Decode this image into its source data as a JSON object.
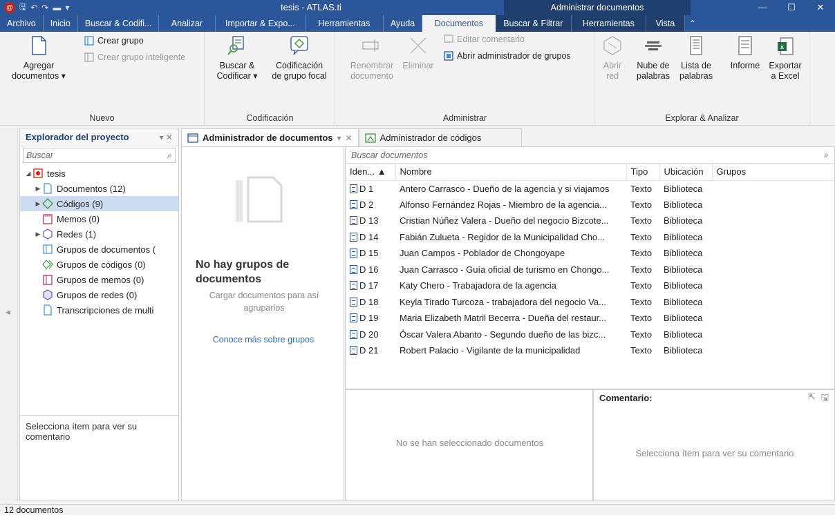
{
  "window": {
    "title": "tesis - ATLAS.ti",
    "context_title": "Administrar documentos",
    "minimize": "—",
    "maximize": "☐",
    "close": "✕"
  },
  "ribbon_tabs": [
    {
      "label": "Archivo"
    },
    {
      "label": "Inicio"
    },
    {
      "label": "Buscar & Codifi..."
    },
    {
      "label": "Analizar"
    },
    {
      "label": "Importar & Expo..."
    },
    {
      "label": "Herramientas"
    },
    {
      "label": "Ayuda"
    },
    {
      "label": "Documentos"
    },
    {
      "label": "Buscar & Filtrar"
    },
    {
      "label": "Herramientas"
    },
    {
      "label": "Vista"
    }
  ],
  "ribbon": {
    "nuevo": {
      "label": "Nuevo",
      "agregar": "Agregar",
      "agregar2": "documentos ▾",
      "crear_grupo": "Crear grupo",
      "crear_inteligente": "Crear grupo inteligente"
    },
    "codificacion": {
      "label": "Codificación",
      "buscar": "Buscar &",
      "buscar2": "Codificar ▾",
      "cod_focal": "Codificación",
      "cod_focal2": "de grupo focal"
    },
    "administrar": {
      "label": "Administrar",
      "renombrar": "Renombrar",
      "renombrar2": "documento",
      "eliminar": "Eliminar",
      "editar": "Editar comentario",
      "abrir_grupos": "Abrir administrador de grupos"
    },
    "explorar": {
      "label": "Explorar & Analizar",
      "abrir_red": "Abrir",
      "abrir_red2": "red",
      "nube": "Nube de",
      "nube2": "palabras",
      "lista": "Lista de",
      "lista2": "palabras",
      "informe": "Informe",
      "exportar": "Exportar",
      "exportar2": "a Excel"
    }
  },
  "explorer": {
    "title": "Explorador del proyecto",
    "controls": "▾ ✕",
    "search_placeholder": "Buscar",
    "tree": [
      {
        "label": "tesis"
      },
      {
        "label": "Documentos (12)"
      },
      {
        "label": "Códigos (9)"
      },
      {
        "label": "Memos (0)"
      },
      {
        "label": "Redes (1)"
      },
      {
        "label": "Grupos de documentos ("
      },
      {
        "label": "Grupos de códigos (0)"
      },
      {
        "label": "Grupos de memos (0)"
      },
      {
        "label": "Grupos de redes (0)"
      },
      {
        "label": "Transcripciones de multi"
      }
    ],
    "comment_hint": "Selecciona ítem para ver su comentario"
  },
  "doc_tabs": [
    {
      "label": "Administrador de documentos"
    },
    {
      "label": "Administrador de códigos"
    }
  ],
  "groups_pane": {
    "title": "No hay grupos de documentos",
    "subtitle": "Cargar documentos para así agruparlos",
    "link": "Conoce más sobre grupos"
  },
  "docs": {
    "search_placeholder": "Buscar documentos",
    "columns": [
      "Iden... ▲",
      "Nombre",
      "Tipo",
      "Ubicación",
      "Grupos"
    ],
    "rows": [
      {
        "id": "D 1",
        "name": "Antero Carrasco - Dueño de la agencia y si viajamos",
        "type": "Texto",
        "loc": "Biblioteca"
      },
      {
        "id": "D 2",
        "name": "Alfonso Fernández Rojas - Miembro de la agencia...",
        "type": "Texto",
        "loc": "Biblioteca"
      },
      {
        "id": "D 13",
        "name": "Cristian Núñez Valera - Dueño del negocio Bizcote...",
        "type": "Texto",
        "loc": "Biblioteca"
      },
      {
        "id": "D 14",
        "name": "Fabián Zulueta - Regidor de la Municipalidad Cho...",
        "type": "Texto",
        "loc": "Biblioteca"
      },
      {
        "id": "D 15",
        "name": "Juan Campos - Poblador de Chongoyape",
        "type": "Texto",
        "loc": "Biblioteca"
      },
      {
        "id": "D 16",
        "name": "Juan Carrasco - Guía oficial de turismo en Chongo...",
        "type": "Texto",
        "loc": "Biblioteca"
      },
      {
        "id": "D 17",
        "name": "Katy Chero - Trabajadora de la agencia",
        "type": "Texto",
        "loc": "Biblioteca"
      },
      {
        "id": "D 18",
        "name": "Keyla Tirado Turcoza - trabajadora del negocio Va...",
        "type": "Texto",
        "loc": "Biblioteca"
      },
      {
        "id": "D 19",
        "name": "Maria Elizabeth Matril Becerra - Dueña del restaur...",
        "type": "Texto",
        "loc": "Biblioteca"
      },
      {
        "id": "D 20",
        "name": "Óscar Valera Abanto - Segundo dueño de las bizc...",
        "type": "Texto",
        "loc": "Biblioteca"
      },
      {
        "id": "D 21",
        "name": "Robert Palacio - Vigilante de la municipalidad",
        "type": "Texto",
        "loc": "Biblioteca"
      }
    ]
  },
  "nodoc_msg": "No se han seleccionado documentos",
  "comment": {
    "label": "Comentario:",
    "hint": "Selecciona ítem para ver su comentario"
  },
  "status": "12 documentos",
  "colors": {
    "accent": "#2b579a",
    "context": "#1f3f6e",
    "selection": "#cddcf0",
    "link": "#1f6fc7"
  }
}
